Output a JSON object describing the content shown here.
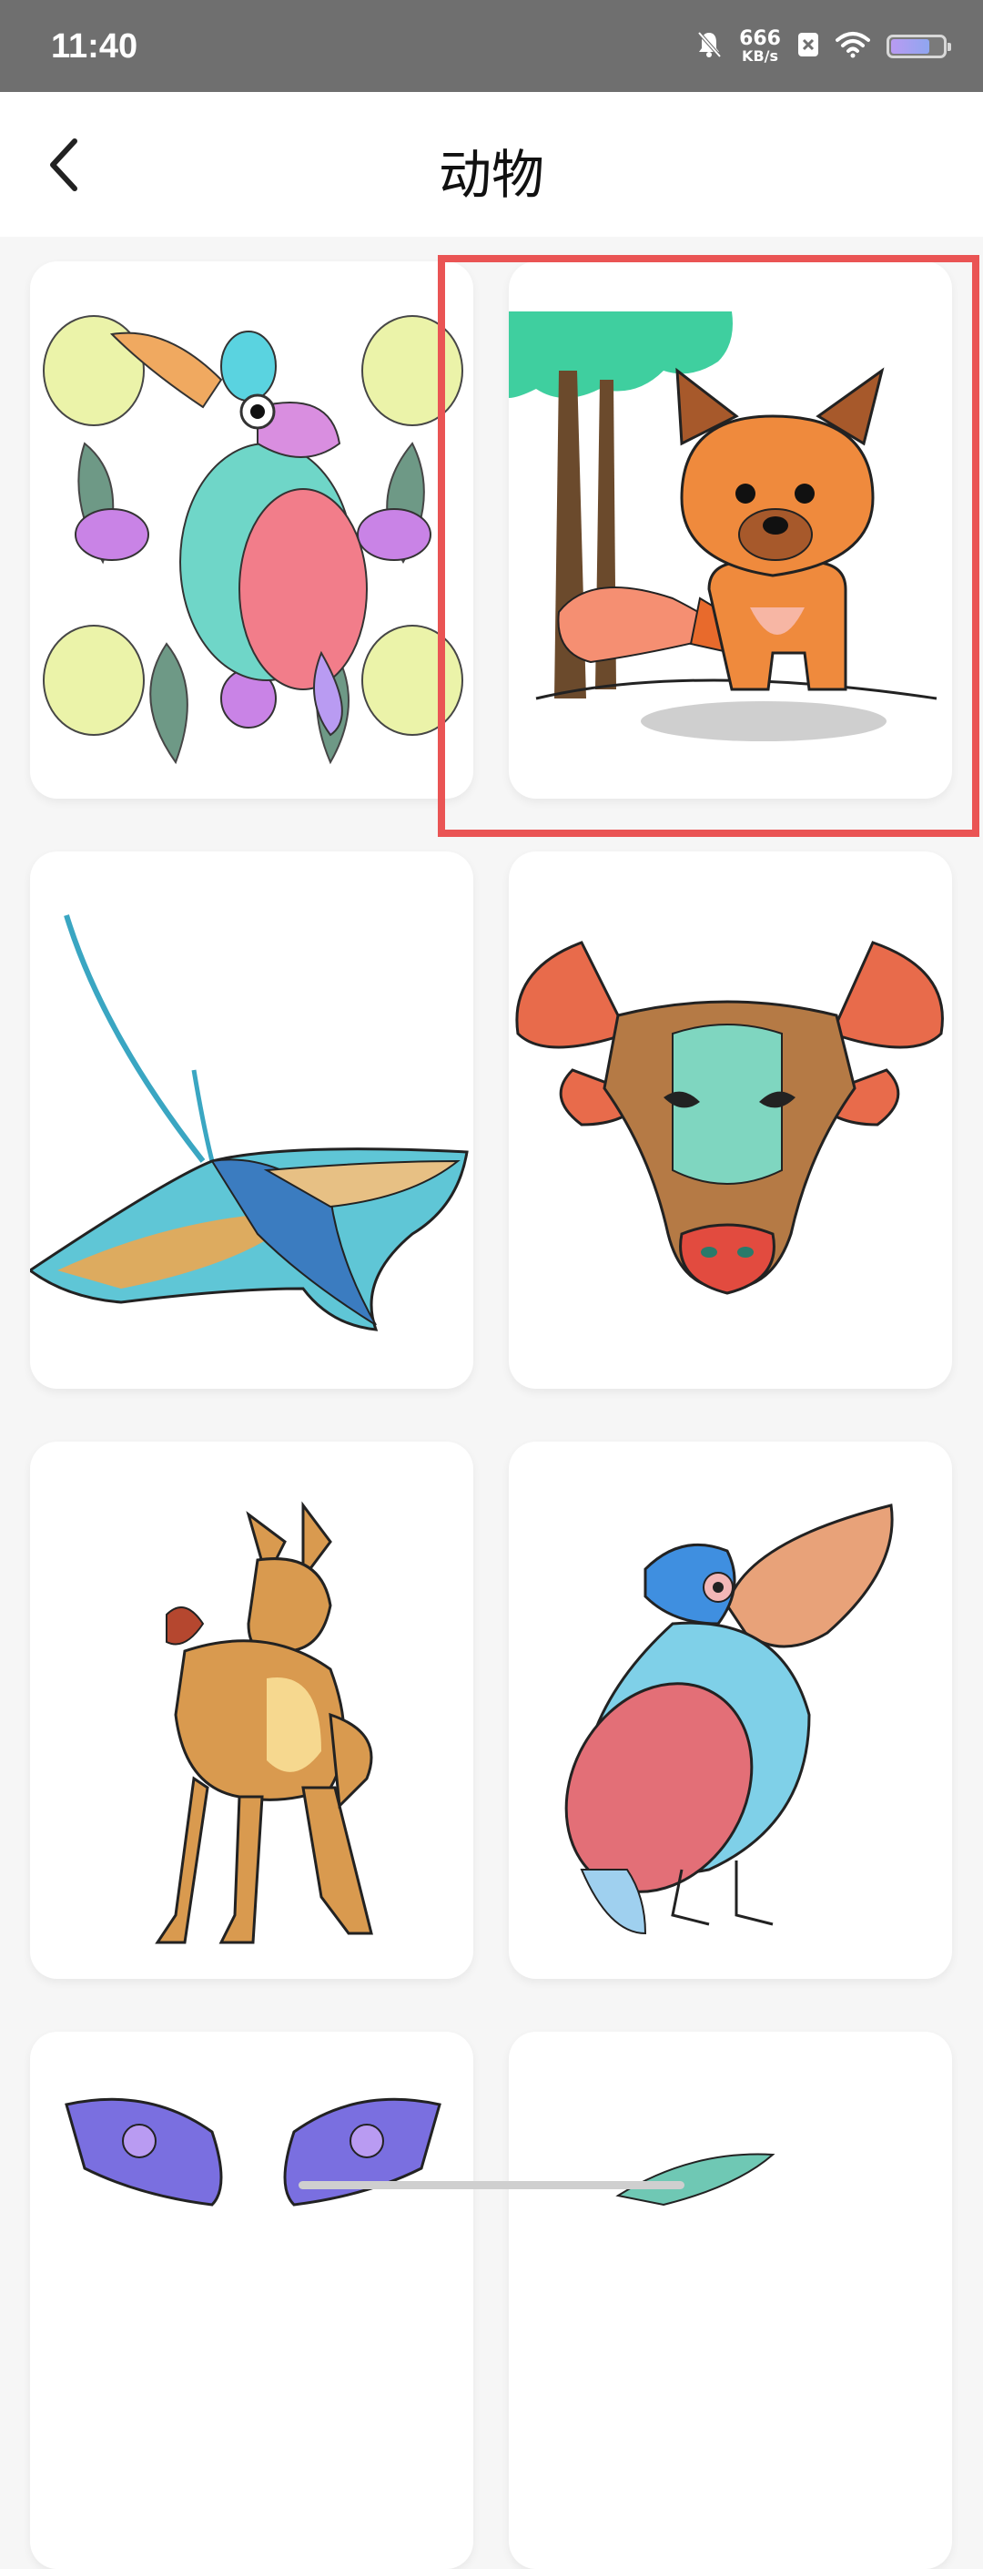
{
  "status_bar": {
    "time": "11:40",
    "net_speed_value": "666",
    "net_speed_unit": "KB/s",
    "icons": [
      "mute-bell-icon",
      "sim-x-icon",
      "wifi-icon",
      "battery-icon"
    ],
    "battery_level": 0.75
  },
  "header": {
    "title": "动物",
    "back_icon": "chevron-left-icon"
  },
  "gallery": {
    "items": [
      {
        "subject": "pelican-mandala",
        "selected": false
      },
      {
        "subject": "fox",
        "selected": true
      },
      {
        "subject": "manta-ray",
        "selected": false
      },
      {
        "subject": "bull-head",
        "selected": false
      },
      {
        "subject": "fawn",
        "selected": false
      },
      {
        "subject": "pelican",
        "selected": false
      },
      {
        "subject": "butterfly",
        "selected": false
      },
      {
        "subject": "leaf-bird",
        "selected": false
      }
    ]
  },
  "colors": {
    "status_bar_bg": "#6f6f6f",
    "highlight": "#ea5454",
    "page_bg": "#f6f6f6"
  }
}
